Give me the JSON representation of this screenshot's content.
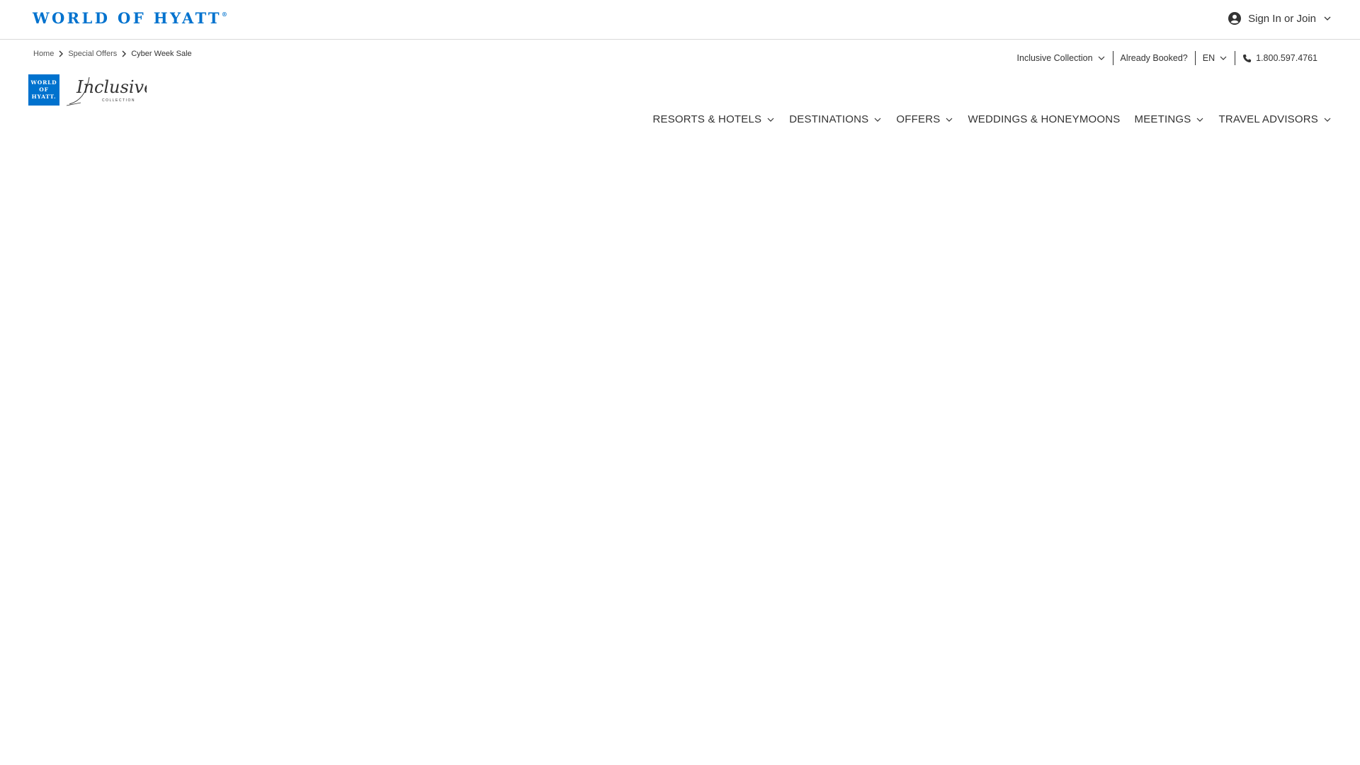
{
  "header": {
    "brand_wordmark": "WORLD OF HYATT",
    "brand_registered": "®",
    "signin_label": "Sign In or Join"
  },
  "breadcrumb": {
    "items": [
      "Home",
      "Special Offers",
      "Cyber Week Sale"
    ]
  },
  "utility_nav": {
    "brand_selector": "Inclusive Collection",
    "already_booked": "Already Booked?",
    "language": "EN",
    "phone": "1.800.597.4761"
  },
  "logo": {
    "box_lines": [
      "WORLD",
      "OF",
      "HYATT."
    ],
    "script_text": "Inclusive",
    "script_sub": "COLLECTION"
  },
  "main_nav": {
    "items": [
      {
        "label": "RESORTS & HOTELS",
        "has_dropdown": true
      },
      {
        "label": "DESTINATIONS",
        "has_dropdown": true
      },
      {
        "label": "OFFERS",
        "has_dropdown": true
      },
      {
        "label": "WEDDINGS & HONEYMOONS",
        "has_dropdown": false
      },
      {
        "label": "MEETINGS",
        "has_dropdown": true
      },
      {
        "label": "TRAVEL ADVISORS",
        "has_dropdown": true
      }
    ]
  },
  "colors": {
    "brand_blue": "#0072ce",
    "text": "#333333",
    "border": "#d9d9d9"
  }
}
